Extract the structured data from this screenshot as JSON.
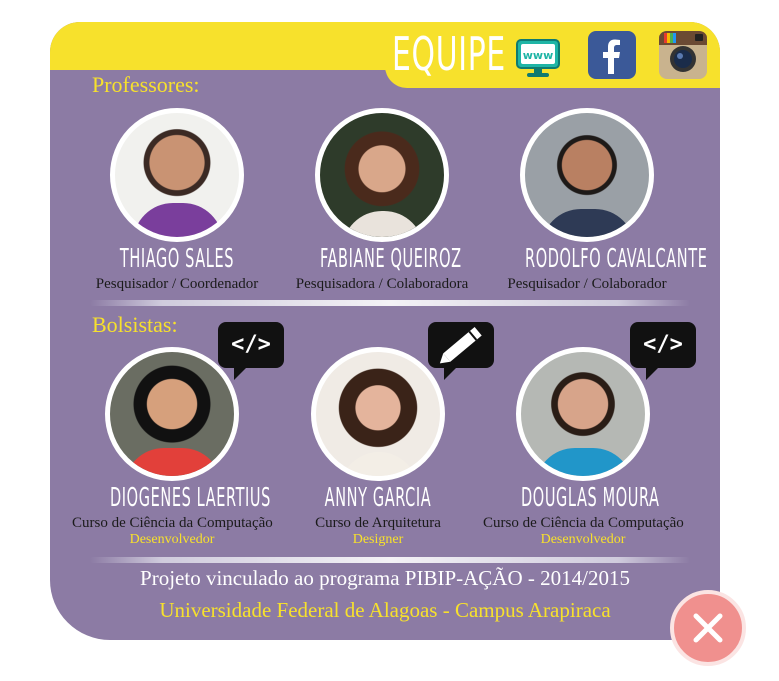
{
  "header": {
    "title": "EQUIPE"
  },
  "icons": {
    "website": "website-icon",
    "facebook": "facebook-icon",
    "instagram": "instagram-icon",
    "website_text": "www"
  },
  "professores": {
    "title": "Professores:",
    "members": [
      {
        "name": "THIAGO SALES",
        "role": "Pesquisador / Coordenador"
      },
      {
        "name": "FABIANE QUEIROZ",
        "role": "Pesquisadora / Colaboradora"
      },
      {
        "name": "RODOLFO CAVALCANTE",
        "role": "Pesquisador / Colaborador"
      }
    ]
  },
  "bolsistas": {
    "title": "Bolsistas:",
    "members": [
      {
        "name": "DIOGENES LAERTIUS",
        "role": "Curso de Ciência da Computação",
        "job": "Desenvolvedor",
        "badge": "</>"
      },
      {
        "name": "ANNY GARCIA",
        "role": "Curso de Arquitetura",
        "job": "Designer",
        "badge": "pencil-icon"
      },
      {
        "name": "DOUGLAS MOURA",
        "role": "Curso de Ciência da Computação",
        "job": "Desenvolvedor",
        "badge": "</>"
      }
    ]
  },
  "footer": {
    "line1": "Projeto vinculado ao programa PIBIP-AÇÃO - 2014/2015",
    "line2": "Universidade Federal de Alagoas - Campus Arapiraca"
  },
  "colors": {
    "panel": "#8c7ba4",
    "accent": "#f7e12c",
    "close": "#f0908e"
  }
}
